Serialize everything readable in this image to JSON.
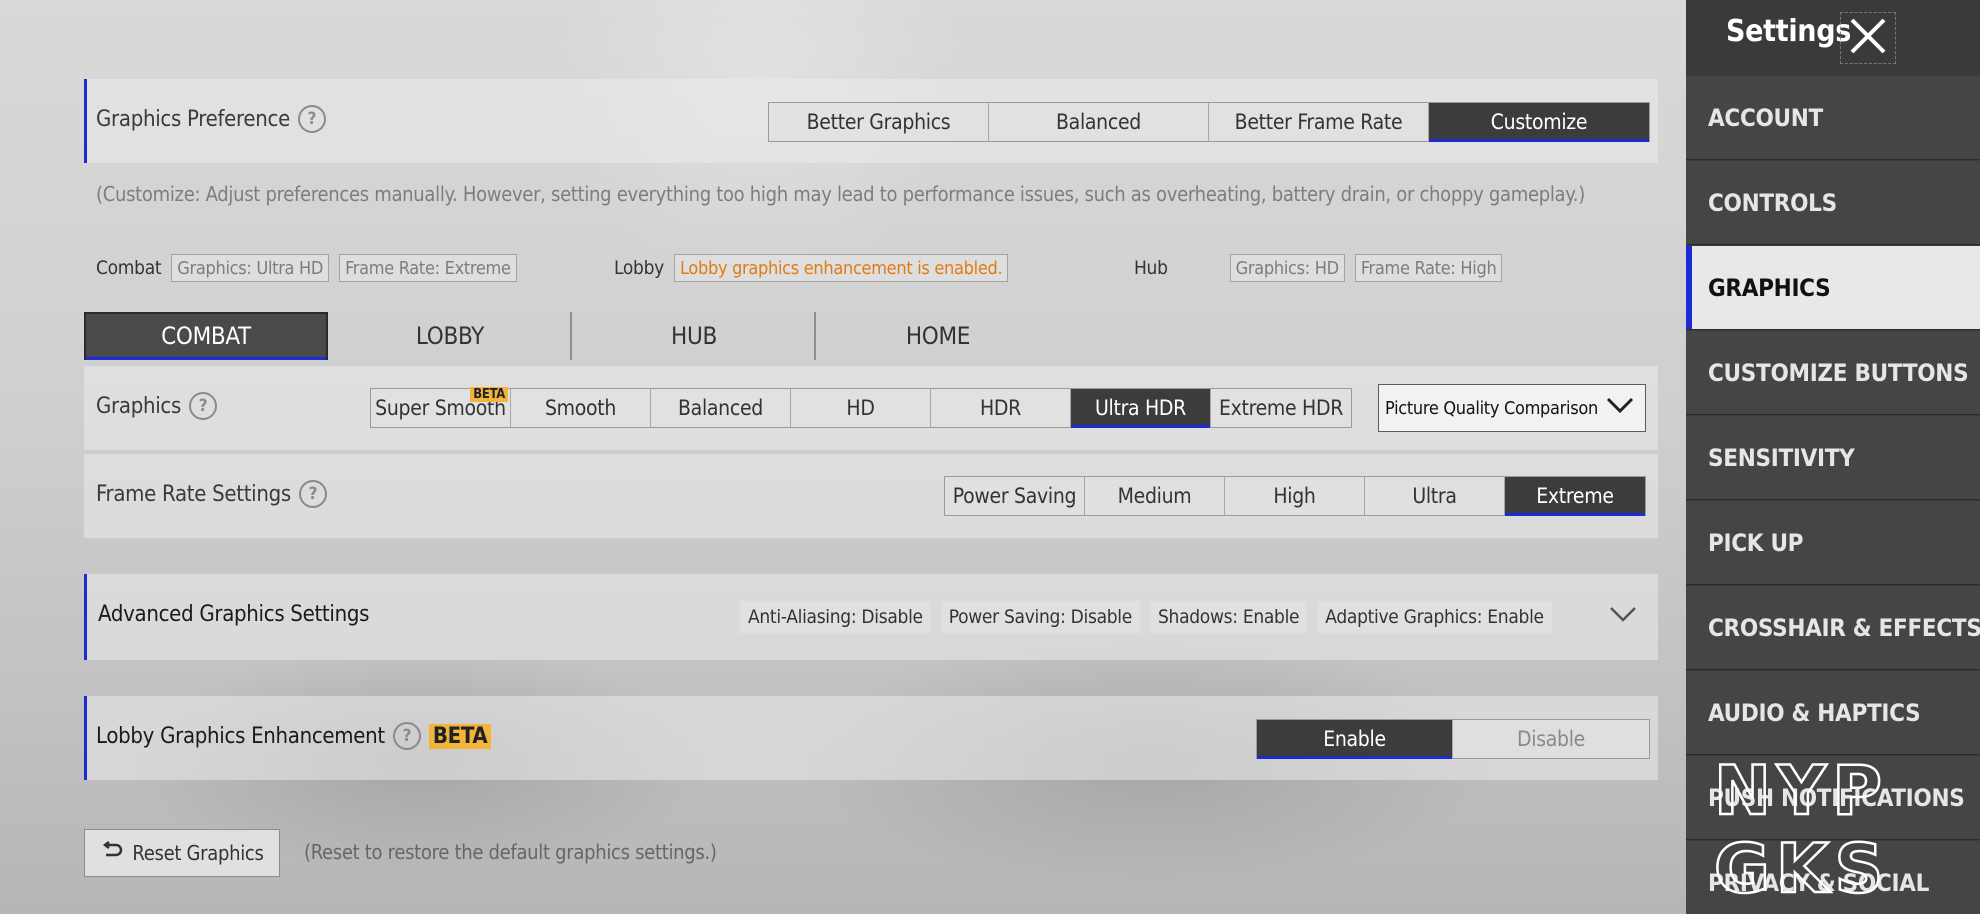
{
  "colors": {
    "accent": "#1c2bd6",
    "orange": "#e07b14",
    "beta": "#f2b43a",
    "sidebar": "#3a3a3a"
  },
  "preference": {
    "label": "Graphics Preference",
    "options": [
      "Better Graphics",
      "Balanced",
      "Better Frame Rate",
      "Customize"
    ],
    "selected": "Customize",
    "hint": "(Customize: Adjust preferences manually. However, setting everything too high may lead to performance issues, such as overheating, battery drain, or choppy gameplay.)",
    "combat_label": "Combat",
    "combat_graphics": "Graphics: Ultra HD",
    "combat_frame": "Frame Rate: Extreme",
    "lobby_label": "Lobby",
    "lobby_status": "Lobby graphics enhancement is enabled.",
    "hub_label": "Hub",
    "hub_graphics": "Graphics: HD",
    "hub_frame": "Frame Rate: High"
  },
  "tabs": [
    "COMBAT",
    "LOBBY",
    "HUB",
    "HOME"
  ],
  "graphics": {
    "label": "Graphics",
    "options": [
      "Super Smooth",
      "Smooth",
      "Balanced",
      "HD",
      "HDR",
      "Ultra HDR",
      "Extreme HDR"
    ],
    "beta_badge": "BETA",
    "selected": "Ultra HDR",
    "comparison_label": "Picture Quality Comparison"
  },
  "frame_rate": {
    "label": "Frame Rate Settings",
    "options": [
      "Power Saving",
      "Medium",
      "High",
      "Ultra",
      "Extreme"
    ],
    "selected": "Extreme"
  },
  "advanced": {
    "label": "Advanced Graphics Settings",
    "chips": [
      "Anti-Aliasing: Disable",
      "Power Saving: Disable",
      "Shadows: Enable",
      "Adaptive Graphics: Enable"
    ]
  },
  "lobby_enhancement": {
    "label": "Lobby Graphics Enhancement",
    "beta": "BETA",
    "options": [
      "Enable",
      "Disable"
    ],
    "selected": "Enable"
  },
  "reset": {
    "label": "Reset Graphics",
    "hint": "(Reset to restore the default graphics settings.)"
  },
  "sidebar": {
    "title": "Settings",
    "items": [
      "ACCOUNT",
      "CONTROLS",
      "GRAPHICS",
      "CUSTOMIZE BUTTONS",
      "SENSITIVITY",
      "PICK UP",
      "CROSSHAIR & EFFECTS",
      "AUDIO & HAPTICS",
      "PUSH NOTIFICATIONS",
      "PRIVACY & SOCIAL"
    ],
    "active": "GRAPHICS"
  },
  "watermark": "NYP GKS"
}
